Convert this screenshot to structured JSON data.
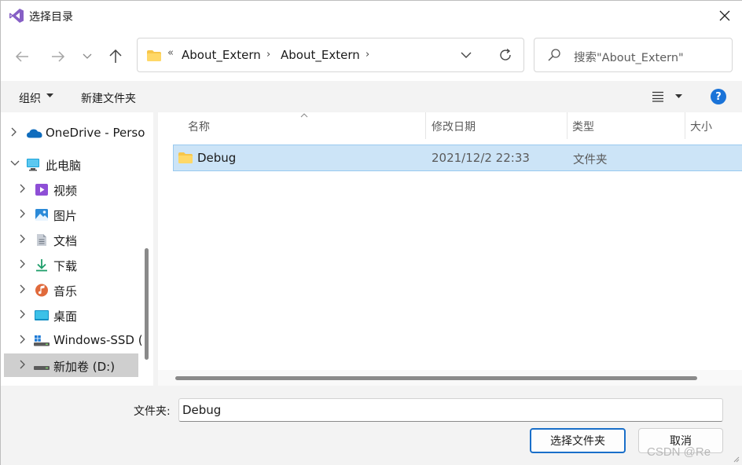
{
  "window": {
    "title": "选择目录"
  },
  "nav": {
    "breadcrumb_overflow": "«",
    "crumbs": [
      "About_Extern",
      "About_Extern"
    ],
    "search_placeholder": "搜索\"About_Extern\""
  },
  "toolbar": {
    "organize_label": "组织",
    "new_folder_label": "新建文件夹",
    "help_label": "?"
  },
  "sidebar": {
    "items": [
      {
        "label": "OneDrive - Perso",
        "icon": "onedrive-icon"
      },
      {
        "label": "此电脑",
        "icon": "computer-icon"
      },
      {
        "label": "视频",
        "icon": "video-icon"
      },
      {
        "label": "图片",
        "icon": "pictures-icon"
      },
      {
        "label": "文档",
        "icon": "documents-icon"
      },
      {
        "label": "下载",
        "icon": "download-icon"
      },
      {
        "label": "音乐",
        "icon": "music-icon"
      },
      {
        "label": "桌面",
        "icon": "desktop-icon"
      },
      {
        "label": "Windows-SSD (",
        "icon": "drive-icon"
      },
      {
        "label": "新加卷 (D:)",
        "icon": "drive-icon"
      }
    ]
  },
  "list": {
    "columns": [
      "名称",
      "修改日期",
      "类型",
      "大小"
    ],
    "rows": [
      {
        "name": "Debug",
        "modified": "2021/12/2 22:33",
        "type": "文件夹",
        "size": ""
      }
    ]
  },
  "footer": {
    "folder_label": "文件夹:",
    "folder_value": "Debug",
    "ok_label": "选择文件夹",
    "cancel_label": "取消",
    "watermark": "CSDN @Re"
  },
  "colors": {
    "accent": "#1a6fc9",
    "selection": "#cce4f7",
    "folder": "#f7c64a"
  }
}
